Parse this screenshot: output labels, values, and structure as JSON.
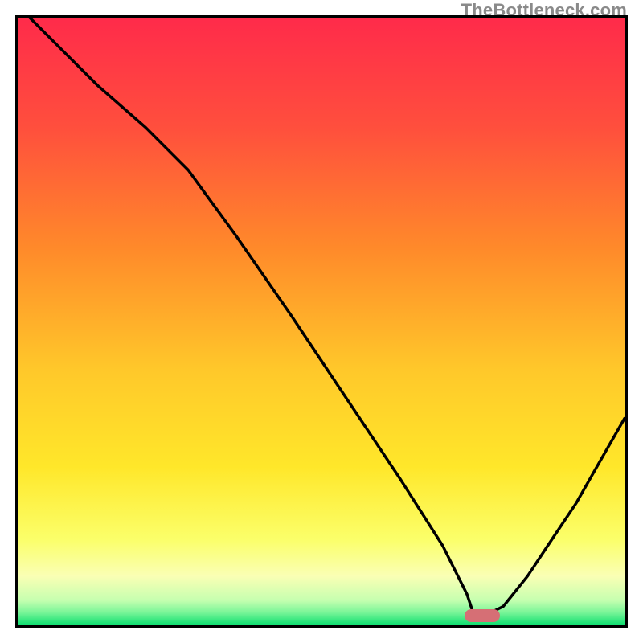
{
  "watermark": "TheBottleneck.com",
  "colors": {
    "gradient_top": "#ff2b4a",
    "gradient_mid1": "#ff8a2a",
    "gradient_mid2": "#ffe72a",
    "gradient_mid3": "#faff9a",
    "gradient_mid4": "#c6ffb0",
    "gradient_bottom": "#12e072",
    "frame": "#000000",
    "curve": "#000000",
    "marker": "#d66f75"
  },
  "chart_data": {
    "type": "line",
    "title": "",
    "xlabel": "",
    "ylabel": "",
    "xlim": [
      0,
      100
    ],
    "ylim": [
      0,
      100
    ],
    "grid": false,
    "series": [
      {
        "name": "bottleneck-curve",
        "x": [
          0,
          6,
          13,
          21,
          28,
          36,
          45,
          55,
          63,
          70,
          74,
          75,
          78,
          80,
          84,
          88,
          92,
          96,
          100
        ],
        "values": [
          102,
          96,
          89,
          82,
          75,
          64,
          51,
          36,
          24,
          13,
          5,
          2,
          2,
          3,
          8,
          14,
          20,
          27,
          34
        ]
      }
    ],
    "marker": {
      "x": 76.5,
      "y": 1.4
    },
    "description": "Qualitative bottleneck heat chart: background transitions from red (high bottleneck) at the top through orange/yellow to green (no bottleneck) at the very bottom. Black curve descends from upper-left to a minimum near x≈76 then rises. Pink pill marks the optimum near the minimum."
  }
}
